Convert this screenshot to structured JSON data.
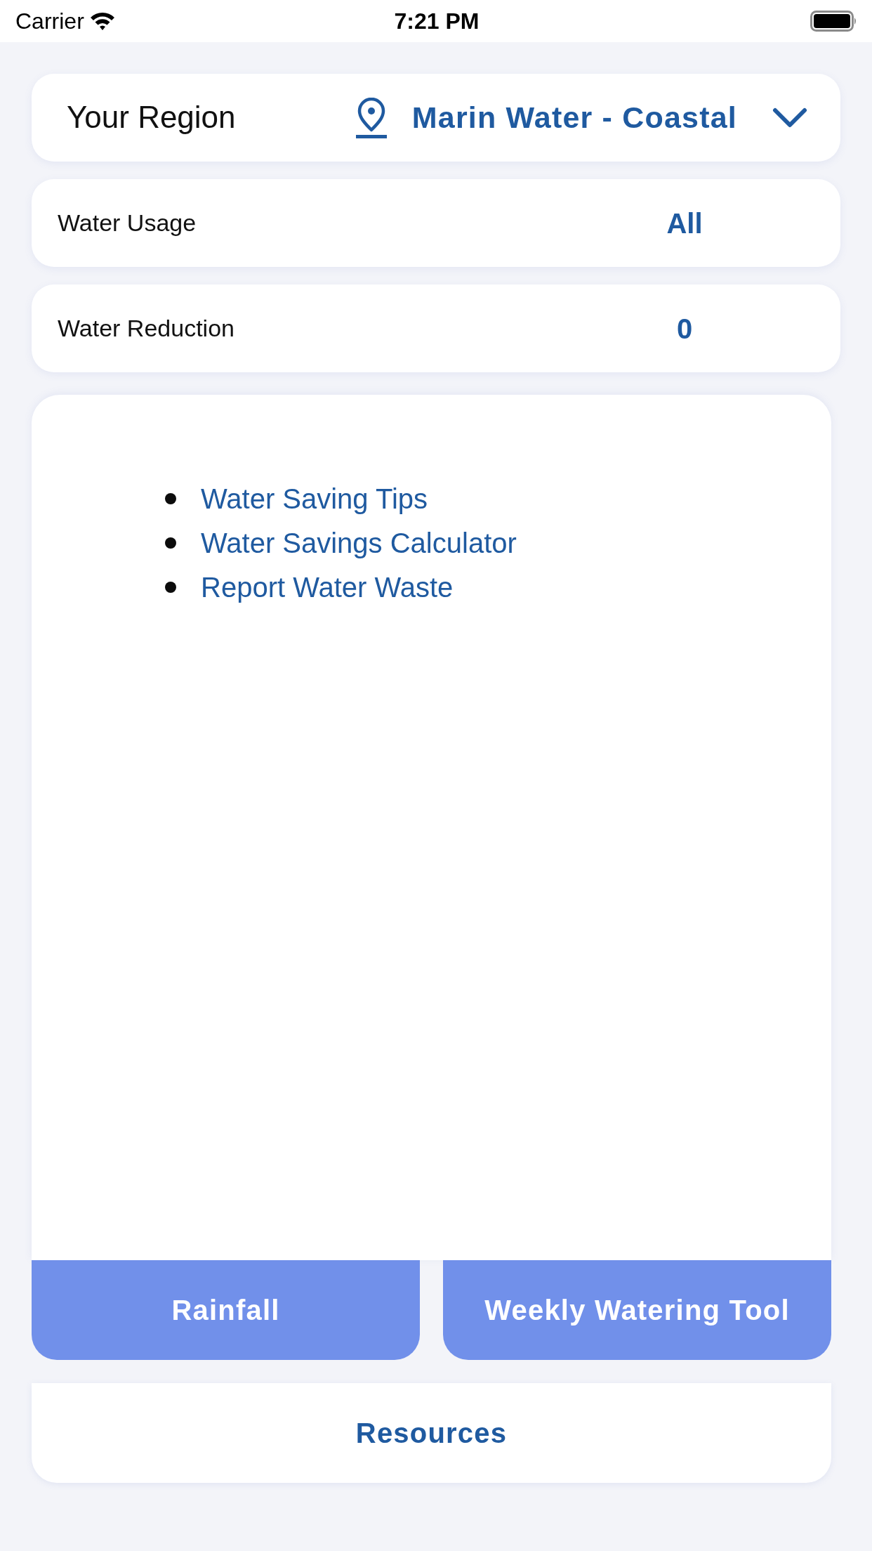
{
  "status_bar": {
    "carrier": "Carrier",
    "time": "7:21 PM"
  },
  "region": {
    "label": "Your Region",
    "value": "Marin Water - Coastal"
  },
  "settings": [
    {
      "label": "Water Usage",
      "value": "All"
    },
    {
      "label": "Water Reduction",
      "value": "0"
    }
  ],
  "links": [
    {
      "label": "Water Saving Tips"
    },
    {
      "label": "Water Savings Calculator"
    },
    {
      "label": "Report Water Waste"
    }
  ],
  "buttons": [
    {
      "label": "Rainfall"
    },
    {
      "label": "Weekly Watering Tool"
    }
  ],
  "resources": {
    "label": "Resources"
  }
}
